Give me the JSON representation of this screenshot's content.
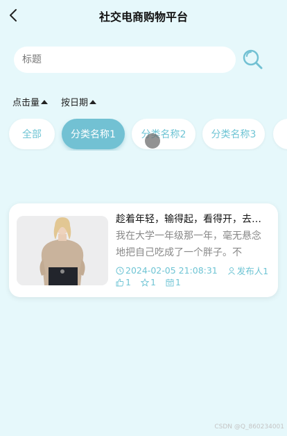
{
  "header": {
    "title": "社交电商购物平台"
  },
  "search": {
    "placeholder": "标题"
  },
  "sort": [
    {
      "label": "点击量"
    },
    {
      "label": "按日期"
    }
  ],
  "categories": [
    {
      "label": "全部",
      "active": false
    },
    {
      "label": "分类名称1",
      "active": true
    },
    {
      "label": "分类名称2",
      "active": false
    },
    {
      "label": "分类名称3",
      "active": false
    }
  ],
  "posts": [
    {
      "title": "趁着年轻，输得起，看得开，去做自己想做的事",
      "excerpt": "我在大学一年级那一年，毫无悬念地把自己吃成了一个胖子。不",
      "datetime": "2024-02-05 21:08:31",
      "author": "发布人1",
      "likes": "1",
      "favorites": "1",
      "views": "1"
    }
  ],
  "watermark": "CSDN @Q_860234001",
  "colors": {
    "accent": "#72c1d3",
    "background": "#e6f8fb"
  }
}
